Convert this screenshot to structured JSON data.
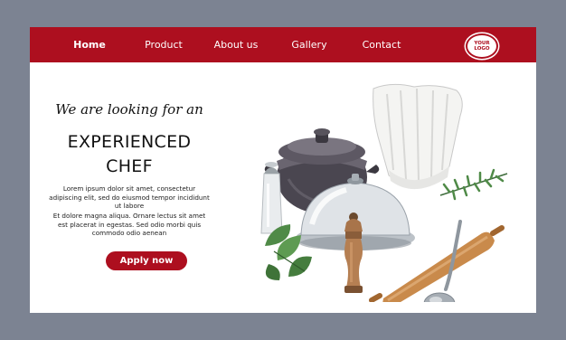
{
  "nav": {
    "items": [
      {
        "label": "Home",
        "active": true
      },
      {
        "label": "Product",
        "active": false
      },
      {
        "label": "About us",
        "active": false
      },
      {
        "label": "Gallery",
        "active": false
      },
      {
        "label": "Contact",
        "active": false
      }
    ],
    "logo_line1": "YOUR",
    "logo_line2": "LOGO"
  },
  "hero": {
    "tagline": "We are looking for an",
    "headline_line1": "EXPERIENCED",
    "headline_line2": "CHEF",
    "paragraph1": "Lorem ipsum dolor sit amet, consectetur adipiscing elit, sed do eiusmod tempor incididunt ut labore",
    "paragraph2": "Et dolore magna aliqua. Ornare lectus sit amet est placerat in egestas. Sed odio morbi quis commodo odio aenean",
    "cta_label": "Apply now"
  },
  "colors": {
    "brand_red": "#ad0f1f",
    "frame_gray": "#7c8392",
    "card_white": "#ffffff"
  },
  "illustration": {
    "icons": [
      "cooking-pot-icon",
      "chef-hat-icon",
      "salt-shaker-icon",
      "cloche-icon",
      "pepper-mill-icon",
      "rolling-pin-icon",
      "ladle-icon",
      "herb-sprig-icon",
      "basil-leaves-icon"
    ]
  }
}
